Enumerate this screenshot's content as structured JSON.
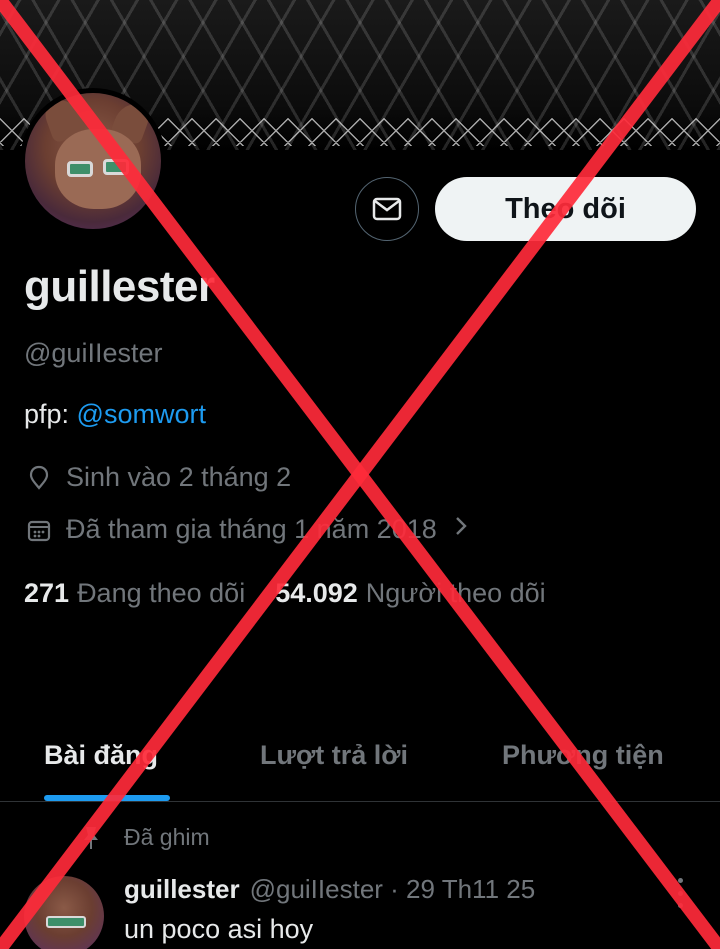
{
  "profile": {
    "display_name": "guillester",
    "handle": "@guiIIester",
    "bio_prefix": "pfp: ",
    "bio_mention": "@somwort",
    "birth": "Sinh vào 2 tháng 2",
    "joined": "Đã tham gia tháng 1 năm 2018",
    "following_count": "271",
    "following_label": "Đang theo dõi",
    "followers_count": "54.092",
    "followers_label": "Người theo dõi"
  },
  "actions": {
    "message_icon": "envelope-icon",
    "follow_label": "Theo dõi"
  },
  "tabs": [
    {
      "label": "Bài đăng",
      "active": true
    },
    {
      "label": "Lượt trả lời",
      "active": false
    },
    {
      "label": "Phương tiện",
      "active": false
    }
  ],
  "pinned_post": {
    "pinned_label": "Đã ghim",
    "author": "guillester",
    "meta": "@guiIIester · 29 Th11 25",
    "text": "un poco asi hoy"
  },
  "colors": {
    "accent": "#1d9bf0",
    "muted": "#71767b",
    "text": "#e7e9ea",
    "overlay_cross": "#ff2b3a"
  },
  "icons": [
    "pin-icon",
    "calendar-icon",
    "location-icon",
    "envelope-icon",
    "chevron-right-icon",
    "more-icon"
  ]
}
